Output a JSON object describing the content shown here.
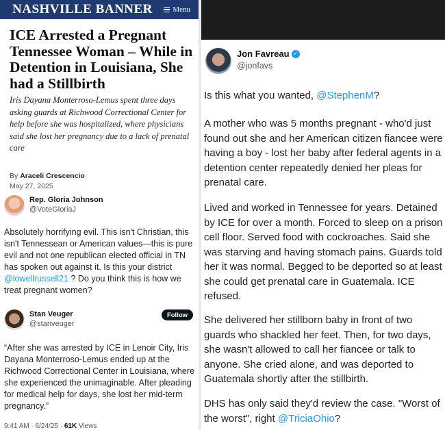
{
  "article": {
    "brand": "NASHVILLE BANNER",
    "menu_label": "Menu",
    "headline": "ICE Arrested a Pregnant Tennessee Woman – While in Detention in Louisiana, She had a Stillbirth",
    "dek": "Iris Dayana Monterroso-Lemus spent three days asking guards at Richwood Correctional Center for help before she was hospitalized, where physicians said she lost her pregnancy due to a lack of prenatal care",
    "byline_prefix": "By",
    "author": "Araceli Crescencio",
    "date": "May 27, 2025"
  },
  "tweet_gj": {
    "name": "Rep. Gloria Johnson",
    "handle": "@VoteGloriaJ",
    "text_1": "Absolutely horrifying evil. This isn't Christian, this isn't Tennessean or American values—this is pure evil and not one republican elected official in TN has spoken out against it. Is this your district ",
    "mention": "@lowellrussell21",
    "text_2": " ? Do you think this is how we treat pregnant women?"
  },
  "tweet_sv": {
    "name": "Stan Veuger",
    "handle": "@stanveuger",
    "follow_label": "Follow",
    "text": "“After she was arrested by ICE in Lenoir City, Iris Dayana Monterroso-Lemus ended up at the Richwood Correctional Center in Louisiana, where she experienced the unimaginable. After pleading for medical help for days, she lost her mid-term pregnancy.”",
    "time": "9:41 AM · 6/24/25 · ",
    "views_count": "61K",
    "views_label": " Views"
  },
  "tweet_jf": {
    "name": "Jon Favreau",
    "handle": "@jonfavs",
    "p1_text": "Is this what you wanted, ",
    "p1_mention": "@StephenM",
    "p1_end": "?",
    "p2": "A mother who was 5 months pregnant - who'd just found out she and her American citizen fiancee were having a boy - lost her baby after federal agents in a detention center repeatedly denied her pleas for prenatal care.",
    "p3": "Lived and worked in Tennessee for years. Detained by ICE for over a month. Forced to sleep on a prison cell floor. Served food with cockroaches. Said she was starving and having stomach pains. Guards told her it was normal. Begged to be deported so at least she could get prenatal care in Guatemala. ICE refused.",
    "p4": "She delivered her stillborn baby in front of two guards who shackled her feet. Then, for two days, she wasn't allowed to call her fiancee or talk to anyone. She cried alone, and was deported to Guatemala shortly after the stillbirth.",
    "p5_text": "DHS has only said they'd review the case. \"Worst of the worst\", right ",
    "p5_mention": "@TriciaOhio",
    "p5_end": "?"
  },
  "icons": {
    "menu": "hamburger-icon",
    "verified": "verified-badge-icon"
  },
  "colors": {
    "banner": "#1e3a6e",
    "link": "#1d9bf0",
    "follow_button": "#0f1419",
    "dark_bar": "#1c1c1c"
  }
}
